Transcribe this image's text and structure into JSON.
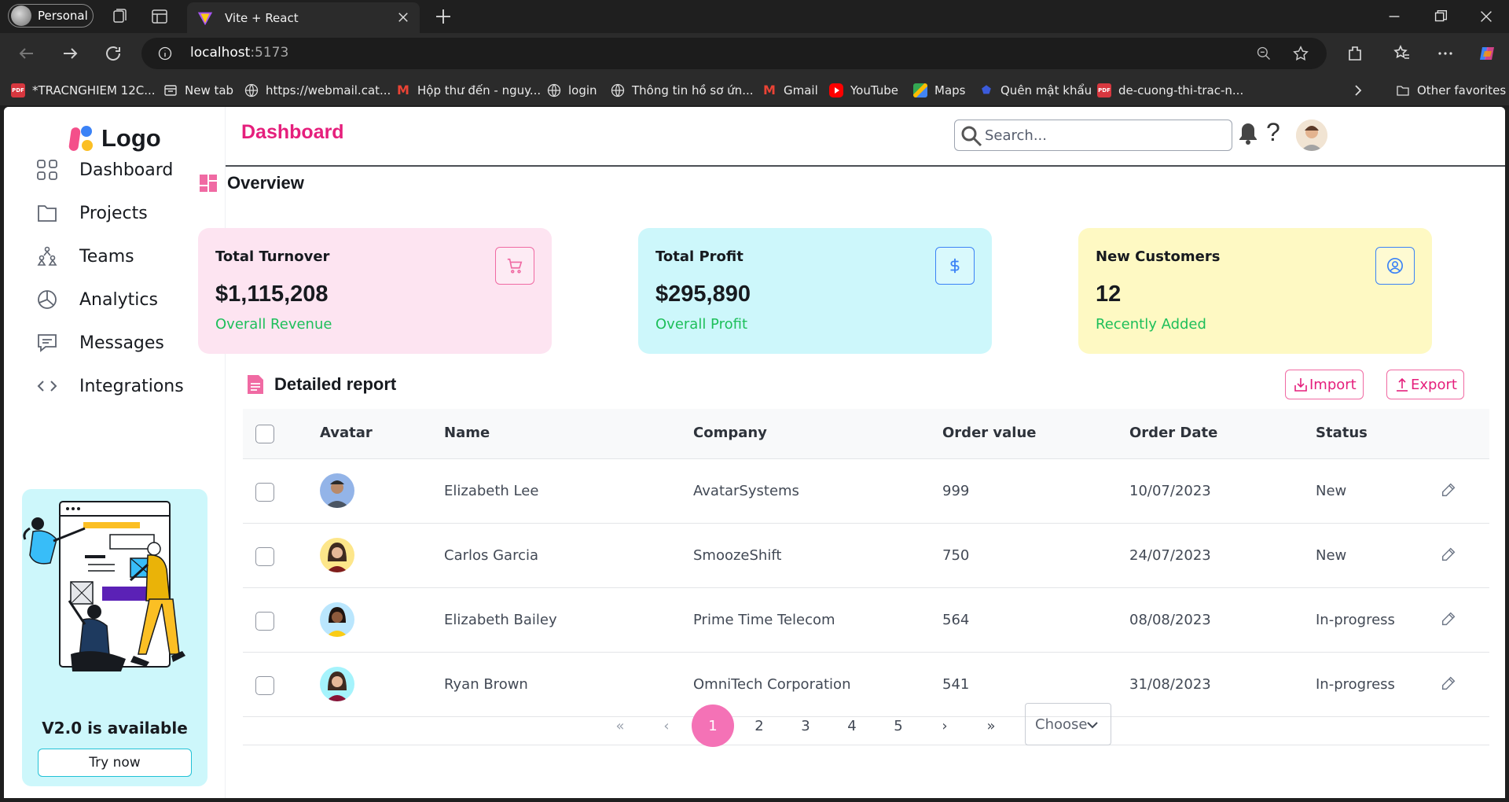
{
  "browser": {
    "profile_label": "Personal",
    "tab_title": "Vite + React",
    "url_host": "localhost",
    "url_port": ":5173",
    "bookmarks": [
      {
        "label": "*TRACNGHIEM 12C...",
        "icon": "pdf-icon"
      },
      {
        "label": "New tab",
        "icon": "newtab-icon"
      },
      {
        "label": "https://webmail.cat...",
        "icon": "globe-icon"
      },
      {
        "label": "Hộp thư đến - nguy...",
        "icon": "gmail-icon"
      },
      {
        "label": "login",
        "icon": "globe-icon"
      },
      {
        "label": "Thông tin hồ sơ ứn...",
        "icon": "globe-icon"
      },
      {
        "label": "Gmail",
        "icon": "gmail-icon"
      },
      {
        "label": "YouTube",
        "icon": "youtube-icon"
      },
      {
        "label": "Maps",
        "icon": "maps-icon"
      },
      {
        "label": "Quên mật khẩu",
        "icon": "shield-icon"
      },
      {
        "label": "de-cuong-thi-trac-n...",
        "icon": "pdf-icon"
      }
    ],
    "other_favorites": "Other favorites"
  },
  "sidebar": {
    "logo_text": "Logo",
    "items": [
      {
        "label": "Dashboard",
        "icon": "grid-icon"
      },
      {
        "label": "Projects",
        "icon": "folder-icon"
      },
      {
        "label": "Teams",
        "icon": "teams-icon"
      },
      {
        "label": "Analytics",
        "icon": "pie-chart-icon"
      },
      {
        "label": "Messages",
        "icon": "message-icon"
      },
      {
        "label": "Integrations",
        "icon": "code-icon"
      }
    ],
    "promo": {
      "title": "V2.0 is available",
      "button": "Try now"
    }
  },
  "header": {
    "title": "Dashboard",
    "search_placeholder": "Search...",
    "help_label": "?"
  },
  "overview": {
    "title": "Overview",
    "cards": [
      {
        "label": "Total Turnover",
        "value": "$1,115,208",
        "sub": "Overall Revenue",
        "icon": "cart-icon",
        "bg": "#fde4f1",
        "accent": "#f06aa3"
      },
      {
        "label": "Total Profit",
        "value": "$295,890",
        "sub": "Overall Profit",
        "icon": "dollar-icon",
        "bg": "#cdf7fb",
        "accent": "#3b82f6"
      },
      {
        "label": "New Customers",
        "value": "12",
        "sub": "Recently Added",
        "icon": "user-circle-icon",
        "bg": "#fef9c3",
        "accent": "#3b82f6"
      }
    ]
  },
  "report": {
    "title": "Detailed report",
    "import_label": "Import",
    "export_label": "Export",
    "columns": [
      "Avatar",
      "Name",
      "Company",
      "Order value",
      "Order Date",
      "Status"
    ],
    "rows": [
      {
        "name": "Elizabeth Lee",
        "company": "AvatarSystems",
        "order_value": "999",
        "order_date": "10/07/2023",
        "status": "New"
      },
      {
        "name": "Carlos Garcia",
        "company": "SmoozeShift",
        "order_value": "750",
        "order_date": "24/07/2023",
        "status": "New"
      },
      {
        "name": "Elizabeth Bailey",
        "company": "Prime Time Telecom",
        "order_value": "564",
        "order_date": "08/08/2023",
        "status": "In-progress"
      },
      {
        "name": "Ryan Brown",
        "company": "OmniTech Corporation",
        "order_value": "541",
        "order_date": "31/08/2023",
        "status": "In-progress"
      }
    ]
  },
  "pagination": {
    "first": "«",
    "prev": "‹",
    "pages": [
      "1",
      "2",
      "3",
      "4",
      "5"
    ],
    "current_page": "1",
    "next": "›",
    "last": "»",
    "select_placeholder": "Choose"
  },
  "colors": {
    "brand_pink": "#e51f7c",
    "active_page": "#f472b6",
    "positive_text": "#1dbf5a"
  }
}
